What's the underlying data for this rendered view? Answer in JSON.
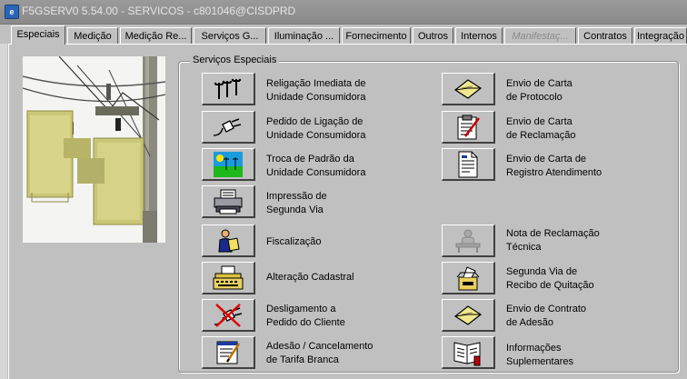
{
  "window": {
    "icon_glyph": "e",
    "title": "F5GSERV0 5.54.00 - SERVICOS - c801046@CISDPRD"
  },
  "tabs": [
    {
      "label": "Especiais",
      "active": true,
      "enabled": true
    },
    {
      "label": "Medição",
      "active": false,
      "enabled": true
    },
    {
      "label": "Medição Re...",
      "active": false,
      "enabled": true
    },
    {
      "label": "Serviços G...",
      "active": false,
      "enabled": true
    },
    {
      "label": "Iluminação ...",
      "active": false,
      "enabled": true
    },
    {
      "label": "Fornecimento",
      "active": false,
      "enabled": true
    },
    {
      "label": "Outros",
      "active": false,
      "enabled": true
    },
    {
      "label": "Internos",
      "active": false,
      "enabled": true
    },
    {
      "label": "Manifestaç...",
      "active": false,
      "enabled": false
    },
    {
      "label": "Contratos",
      "active": false,
      "enabled": true
    },
    {
      "label": "Integração",
      "active": false,
      "enabled": true
    }
  ],
  "group": {
    "title": "Serviços Especiais"
  },
  "services_left": [
    {
      "line1": "Religação Imediata de",
      "line2": "Unidade Consumidora",
      "icon": "power-pole-icon",
      "enabled": true
    },
    {
      "line1": "Pedido de Ligação de",
      "line2": "Unidade Consumidora",
      "icon": "plug-icon",
      "enabled": true
    },
    {
      "line1": "Troca de Padrão da",
      "line2": "Unidade Consumidora",
      "icon": "landscape-icon",
      "enabled": true
    },
    {
      "line1": "Impressão de",
      "line2": "Segunda Via",
      "icon": "printer-icon",
      "enabled": true
    },
    {
      "line1": "Fiscalização",
      "line2": "",
      "icon": "inspector-icon",
      "enabled": true
    },
    {
      "line1": "Alteração Cadastral",
      "line2": "",
      "icon": "typewriter-icon",
      "enabled": true
    },
    {
      "line1": "Desligamento a",
      "line2": "Pedido do Cliente",
      "icon": "unplug-icon",
      "enabled": true
    },
    {
      "line1": "Adesão / Cancelamento",
      "line2": "de Tarifa Branca",
      "icon": "signed-form-icon",
      "enabled": true
    }
  ],
  "services_right": [
    {
      "line1": "Envio de Carta",
      "line2": "de Protocolo",
      "icon": "envelope-icon",
      "enabled": true
    },
    {
      "line1": "Envio de Carta",
      "line2": "de Reclamação",
      "icon": "clipboard-icon",
      "enabled": true
    },
    {
      "line1": "Envio de Carta de",
      "line2": "Registro Atendimento",
      "icon": "document-icon",
      "enabled": true
    },
    {
      "line1": "Nota de Reclamação",
      "line2": "Técnica",
      "icon": "desk-person-icon",
      "enabled": false
    },
    {
      "line1": "Segunda Via de",
      "line2": "Recibo de Quitação",
      "icon": "mailbox-icon",
      "enabled": true
    },
    {
      "line1": "Envio de Contrato",
      "line2": "de Adesão",
      "icon": "envelope-icon",
      "enabled": true
    },
    {
      "line1": "Informações",
      "line2": "Suplementares",
      "icon": "book-icon",
      "enabled": true
    }
  ]
}
